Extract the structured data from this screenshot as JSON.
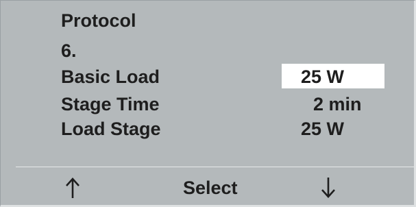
{
  "screen": {
    "heading": "Protocol",
    "protocol_number": "6.",
    "rows": [
      {
        "label": "Basic Load",
        "value": "25 W",
        "selected": true
      },
      {
        "label": "Stage Time",
        "value": "2 min",
        "selected": false
      },
      {
        "label": "Load Stage",
        "value": "25 W",
        "selected": false
      }
    ]
  },
  "softkeys": {
    "up_icon": "up-arrow-icon",
    "select_label": "Select",
    "down_icon": "down-arrow-icon"
  },
  "colors": {
    "screen_background": "#b4b9bb",
    "text": "#1e1e1e",
    "selection_highlight": "#ffffff",
    "divider": "#e6e9ea"
  }
}
